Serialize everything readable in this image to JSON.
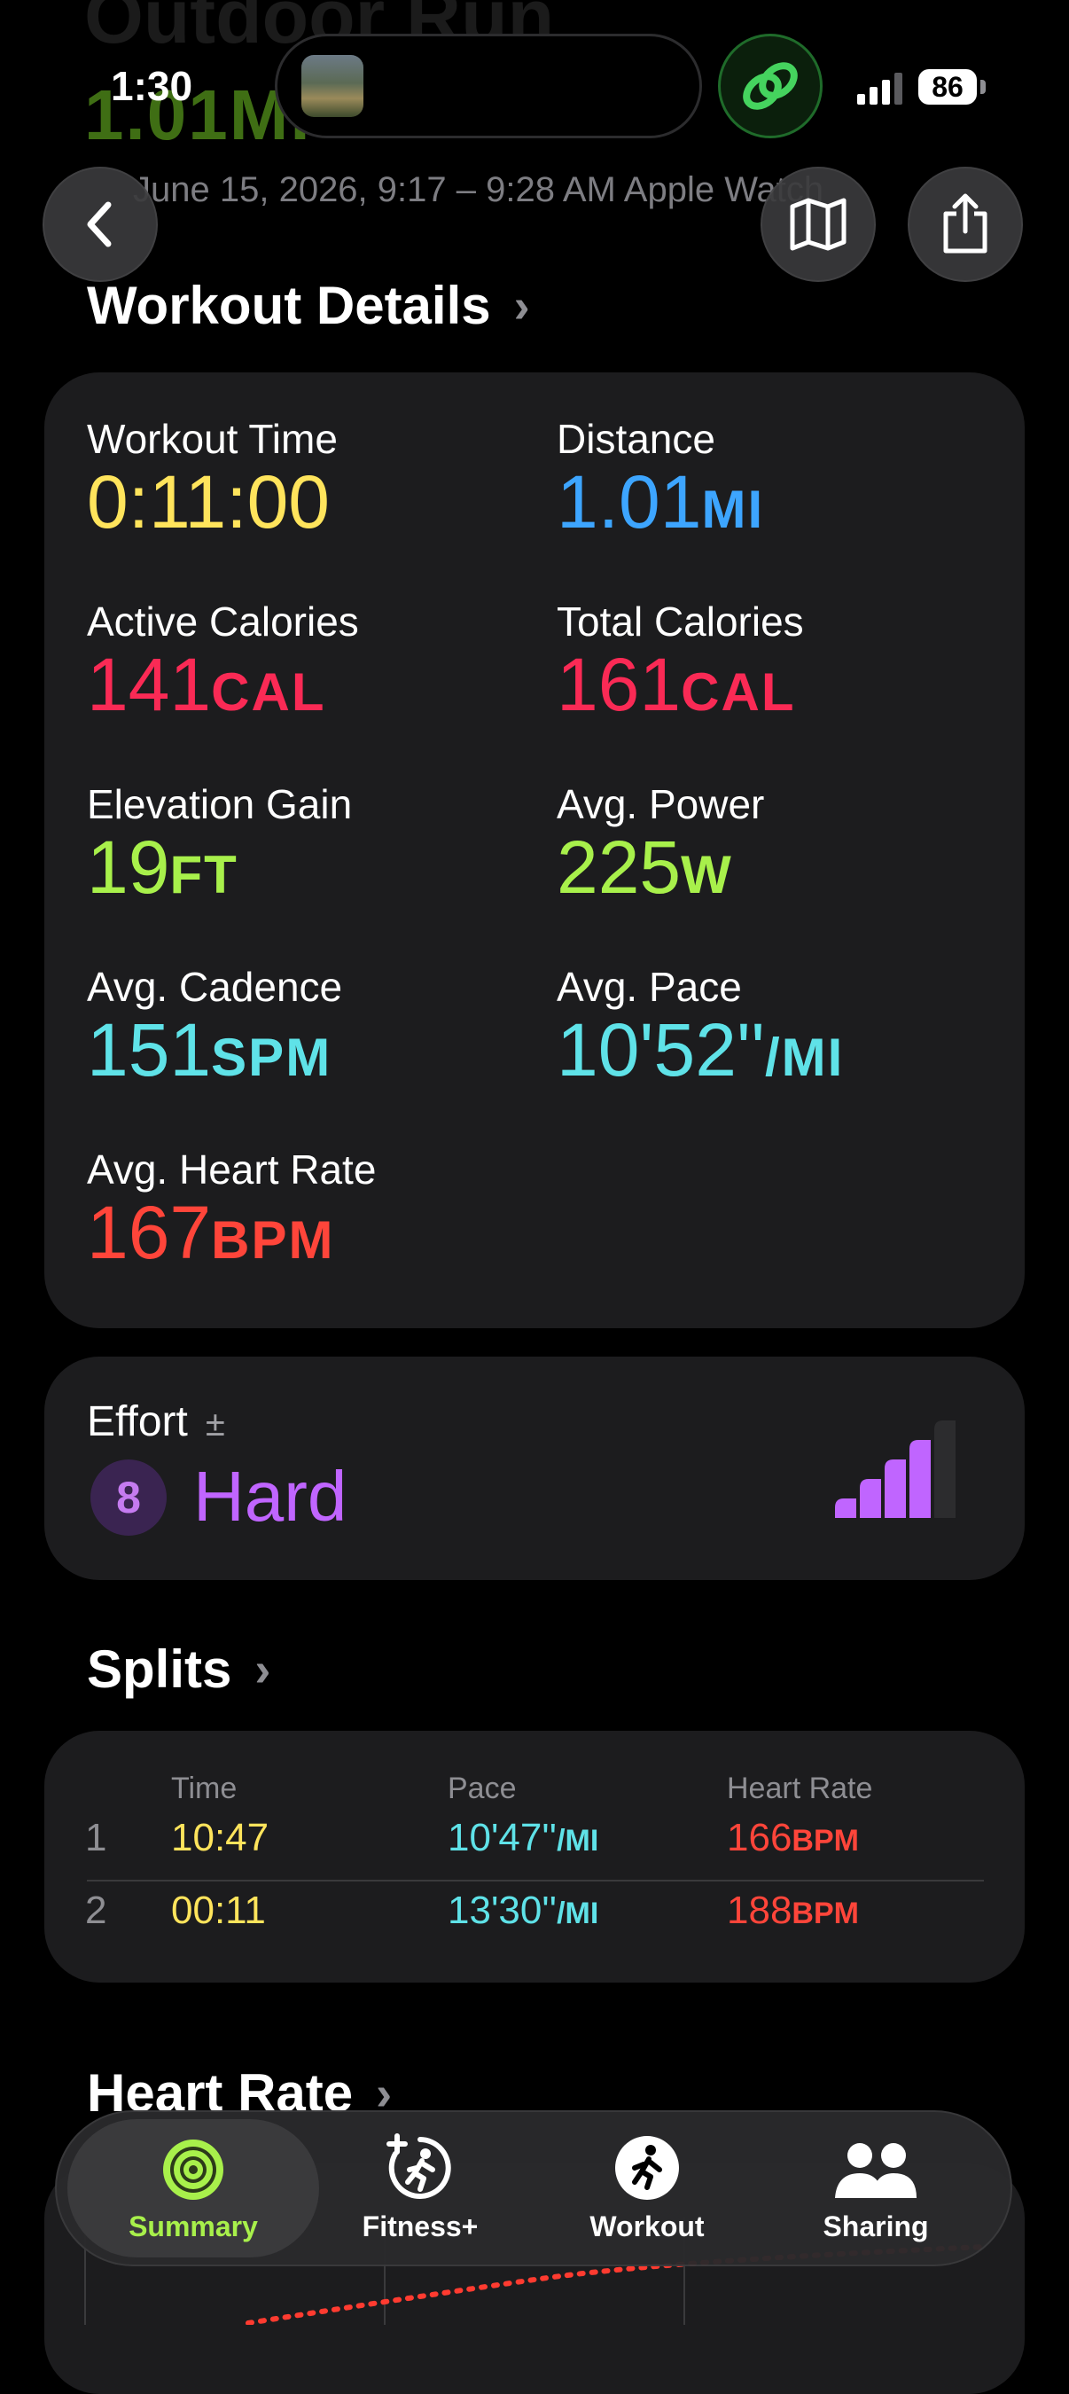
{
  "status_bar": {
    "time": "1:30",
    "battery": "86"
  },
  "header": {
    "ghost_title": "Outdoor Run",
    "ghost_distance": "1.01MI",
    "subtitle": "June 15, 2026, 9:17 – 9:28 AM  Apple Watch"
  },
  "workout_details": {
    "title": "Workout Details",
    "stats": [
      {
        "label": "Workout Time",
        "value": "0:11:00",
        "unit": "",
        "color": "#FFE45C"
      },
      {
        "label": "Distance",
        "value": "1.01",
        "unit": "MI",
        "color": "#3DA5FF"
      },
      {
        "label": "Active Calories",
        "value": "141",
        "unit": "CAL",
        "color": "#FA2A55"
      },
      {
        "label": "Total Calories",
        "value": "161",
        "unit": "CAL",
        "color": "#FA2A55"
      },
      {
        "label": "Elevation Gain",
        "value": "19",
        "unit": "FT",
        "color": "#A8F04B"
      },
      {
        "label": "Avg. Power",
        "value": "225",
        "unit": "W",
        "color": "#A8F04B"
      },
      {
        "label": "Avg. Cadence",
        "value": "151",
        "unit": "SPM",
        "color": "#5FE2E8"
      },
      {
        "label": "Avg. Pace",
        "value": "10'52''",
        "unit": "/MI",
        "color": "#5FE2E8"
      },
      {
        "label": "Avg. Heart Rate",
        "value": "167",
        "unit": "BPM",
        "color": "#FF453A"
      }
    ]
  },
  "effort": {
    "label": "Effort",
    "adjust_symbol": "±",
    "score": "8",
    "word": "Hard",
    "level": 4,
    "max_level": 5
  },
  "splits": {
    "title": "Splits",
    "headers": {
      "time": "Time",
      "pace": "Pace",
      "heart_rate": "Heart Rate"
    },
    "rows": [
      {
        "index": "1",
        "time": "10:47",
        "pace": "10'47''",
        "pace_unit": "/MI",
        "hr": "166",
        "hr_unit": "BPM"
      },
      {
        "index": "2",
        "time": "00:11",
        "pace": "13'30''",
        "pace_unit": "/MI",
        "hr": "188",
        "hr_unit": "BPM"
      }
    ]
  },
  "heart_rate_section": {
    "title": "Heart Rate"
  },
  "tabs": [
    {
      "label": "Summary",
      "icon": "activity-rings-icon",
      "active": true
    },
    {
      "label": "Fitness+",
      "icon": "fitness-plus-icon",
      "active": false
    },
    {
      "label": "Workout",
      "icon": "running-figure-icon",
      "active": false
    },
    {
      "label": "Sharing",
      "icon": "people-icon",
      "active": false
    }
  ],
  "colors": {
    "yellow": "#FFE45C",
    "blue": "#3DA5FF",
    "red": "#FA2A55",
    "green": "#A8F04B",
    "cyan": "#5FE2E8",
    "heart_red": "#FF453A",
    "purple": "#C065FF",
    "card": "#1C1C1E"
  }
}
